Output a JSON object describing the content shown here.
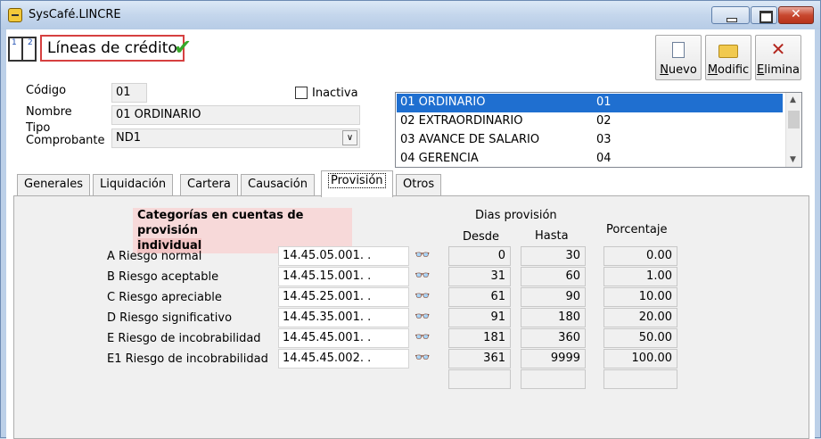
{
  "window": {
    "title": "SysCafé.LINCRE"
  },
  "form": {
    "title": "Líneas de crédito",
    "book_num1": "1",
    "book_num2": "2"
  },
  "toolbar": {
    "nuevo": {
      "first": "N",
      "rest": "uevo"
    },
    "modificar": {
      "first": "M",
      "rest": "odific"
    },
    "eliminar": {
      "first": "E",
      "rest": "limina"
    }
  },
  "fields": {
    "codigo_label": "Código",
    "codigo_value": "01",
    "nombre_label": "Nombre",
    "nombre_value": "01 ORDINARIO",
    "tipo_label_1": "Tipo",
    "tipo_label_2": "Comprobante",
    "tipo_value": "ND1",
    "inactiva_label": "Inactiva"
  },
  "list": [
    {
      "name": "01 ORDINARIO",
      "code": "01",
      "selected": true
    },
    {
      "name": "02 EXTRAORDINARIO",
      "code": "02",
      "selected": false
    },
    {
      "name": "03 AVANCE DE SALARIO",
      "code": "03",
      "selected": false
    },
    {
      "name": "04 GERENCIA",
      "code": "04",
      "selected": false
    }
  ],
  "tabs": [
    "Generales",
    "Liquidación",
    "Cartera",
    "Causación",
    "Provisión",
    "Otros"
  ],
  "active_tab": "Provisión",
  "provision": {
    "cat_title_1": "Categorías en cuentas de provisión",
    "cat_title_2": "individual",
    "dias_header": "Dias provisión",
    "desde_header": "Desde",
    "hasta_header": "Hasta",
    "porcentaje_header": "Porcentaje",
    "rows": [
      {
        "label": "A Riesgo normal",
        "account": "14.45.05.001.  .",
        "desde": "0",
        "hasta": "30",
        "porcentaje": "0.00"
      },
      {
        "label": "B Riesgo aceptable",
        "account": "14.45.15.001.  .",
        "desde": "31",
        "hasta": "60",
        "porcentaje": "1.00"
      },
      {
        "label": "C Riesgo apreciable",
        "account": "14.45.25.001.  .",
        "desde": "61",
        "hasta": "90",
        "porcentaje": "10.00"
      },
      {
        "label": "D Riesgo significativo",
        "account": "14.45.35.001.  .",
        "desde": "91",
        "hasta": "180",
        "porcentaje": "20.00"
      },
      {
        "label": "E Riesgo de incobrabilidad",
        "account": "14.45.45.001.  .",
        "desde": "181",
        "hasta": "360",
        "porcentaje": "50.00"
      },
      {
        "label": "E1 Riesgo de incobrabilidad",
        "account": "14.45.45.002.  .",
        "desde": "361",
        "hasta": "9999",
        "porcentaje": "100.00"
      }
    ]
  },
  "colors": {
    "selection": "#1f6fd0",
    "title_border": "#d64040",
    "category_bg": "#f7d9d9",
    "check": "#36a82a"
  }
}
